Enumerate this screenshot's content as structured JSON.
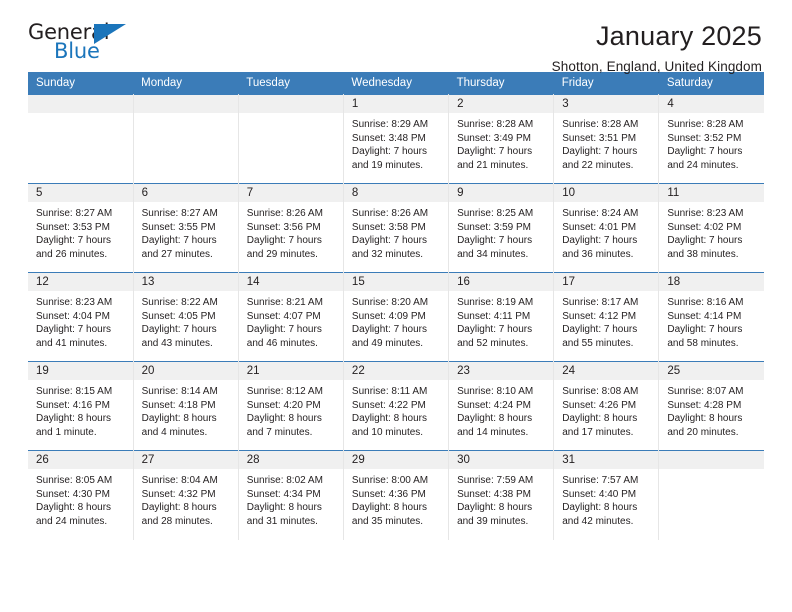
{
  "brand": {
    "name_part1": "General",
    "name_part2": "Blue",
    "accent_color": "#1b75bb"
  },
  "header": {
    "month_title": "January 2025",
    "location": "Shotton, England, United Kingdom",
    "header_bg_color": "#3b7cb8"
  },
  "weekdays": [
    {
      "label": "Sunday"
    },
    {
      "label": "Monday"
    },
    {
      "label": "Tuesday"
    },
    {
      "label": "Wednesday"
    },
    {
      "label": "Thursday"
    },
    {
      "label": "Friday"
    },
    {
      "label": "Saturday"
    }
  ],
  "weeks": [
    [
      {
        "day": "",
        "sunrise": "",
        "sunset": "",
        "daylight1": "",
        "daylight2": ""
      },
      {
        "day": "",
        "sunrise": "",
        "sunset": "",
        "daylight1": "",
        "daylight2": ""
      },
      {
        "day": "",
        "sunrise": "",
        "sunset": "",
        "daylight1": "",
        "daylight2": ""
      },
      {
        "day": "1",
        "sunrise": "Sunrise: 8:29 AM",
        "sunset": "Sunset: 3:48 PM",
        "daylight1": "Daylight: 7 hours",
        "daylight2": "and 19 minutes."
      },
      {
        "day": "2",
        "sunrise": "Sunrise: 8:28 AM",
        "sunset": "Sunset: 3:49 PM",
        "daylight1": "Daylight: 7 hours",
        "daylight2": "and 21 minutes."
      },
      {
        "day": "3",
        "sunrise": "Sunrise: 8:28 AM",
        "sunset": "Sunset: 3:51 PM",
        "daylight1": "Daylight: 7 hours",
        "daylight2": "and 22 minutes."
      },
      {
        "day": "4",
        "sunrise": "Sunrise: 8:28 AM",
        "sunset": "Sunset: 3:52 PM",
        "daylight1": "Daylight: 7 hours",
        "daylight2": "and 24 minutes."
      }
    ],
    [
      {
        "day": "5",
        "sunrise": "Sunrise: 8:27 AM",
        "sunset": "Sunset: 3:53 PM",
        "daylight1": "Daylight: 7 hours",
        "daylight2": "and 26 minutes."
      },
      {
        "day": "6",
        "sunrise": "Sunrise: 8:27 AM",
        "sunset": "Sunset: 3:55 PM",
        "daylight1": "Daylight: 7 hours",
        "daylight2": "and 27 minutes."
      },
      {
        "day": "7",
        "sunrise": "Sunrise: 8:26 AM",
        "sunset": "Sunset: 3:56 PM",
        "daylight1": "Daylight: 7 hours",
        "daylight2": "and 29 minutes."
      },
      {
        "day": "8",
        "sunrise": "Sunrise: 8:26 AM",
        "sunset": "Sunset: 3:58 PM",
        "daylight1": "Daylight: 7 hours",
        "daylight2": "and 32 minutes."
      },
      {
        "day": "9",
        "sunrise": "Sunrise: 8:25 AM",
        "sunset": "Sunset: 3:59 PM",
        "daylight1": "Daylight: 7 hours",
        "daylight2": "and 34 minutes."
      },
      {
        "day": "10",
        "sunrise": "Sunrise: 8:24 AM",
        "sunset": "Sunset: 4:01 PM",
        "daylight1": "Daylight: 7 hours",
        "daylight2": "and 36 minutes."
      },
      {
        "day": "11",
        "sunrise": "Sunrise: 8:23 AM",
        "sunset": "Sunset: 4:02 PM",
        "daylight1": "Daylight: 7 hours",
        "daylight2": "and 38 minutes."
      }
    ],
    [
      {
        "day": "12",
        "sunrise": "Sunrise: 8:23 AM",
        "sunset": "Sunset: 4:04 PM",
        "daylight1": "Daylight: 7 hours",
        "daylight2": "and 41 minutes."
      },
      {
        "day": "13",
        "sunrise": "Sunrise: 8:22 AM",
        "sunset": "Sunset: 4:05 PM",
        "daylight1": "Daylight: 7 hours",
        "daylight2": "and 43 minutes."
      },
      {
        "day": "14",
        "sunrise": "Sunrise: 8:21 AM",
        "sunset": "Sunset: 4:07 PM",
        "daylight1": "Daylight: 7 hours",
        "daylight2": "and 46 minutes."
      },
      {
        "day": "15",
        "sunrise": "Sunrise: 8:20 AM",
        "sunset": "Sunset: 4:09 PM",
        "daylight1": "Daylight: 7 hours",
        "daylight2": "and 49 minutes."
      },
      {
        "day": "16",
        "sunrise": "Sunrise: 8:19 AM",
        "sunset": "Sunset: 4:11 PM",
        "daylight1": "Daylight: 7 hours",
        "daylight2": "and 52 minutes."
      },
      {
        "day": "17",
        "sunrise": "Sunrise: 8:17 AM",
        "sunset": "Sunset: 4:12 PM",
        "daylight1": "Daylight: 7 hours",
        "daylight2": "and 55 minutes."
      },
      {
        "day": "18",
        "sunrise": "Sunrise: 8:16 AM",
        "sunset": "Sunset: 4:14 PM",
        "daylight1": "Daylight: 7 hours",
        "daylight2": "and 58 minutes."
      }
    ],
    [
      {
        "day": "19",
        "sunrise": "Sunrise: 8:15 AM",
        "sunset": "Sunset: 4:16 PM",
        "daylight1": "Daylight: 8 hours",
        "daylight2": "and 1 minute."
      },
      {
        "day": "20",
        "sunrise": "Sunrise: 8:14 AM",
        "sunset": "Sunset: 4:18 PM",
        "daylight1": "Daylight: 8 hours",
        "daylight2": "and 4 minutes."
      },
      {
        "day": "21",
        "sunrise": "Sunrise: 8:12 AM",
        "sunset": "Sunset: 4:20 PM",
        "daylight1": "Daylight: 8 hours",
        "daylight2": "and 7 minutes."
      },
      {
        "day": "22",
        "sunrise": "Sunrise: 8:11 AM",
        "sunset": "Sunset: 4:22 PM",
        "daylight1": "Daylight: 8 hours",
        "daylight2": "and 10 minutes."
      },
      {
        "day": "23",
        "sunrise": "Sunrise: 8:10 AM",
        "sunset": "Sunset: 4:24 PM",
        "daylight1": "Daylight: 8 hours",
        "daylight2": "and 14 minutes."
      },
      {
        "day": "24",
        "sunrise": "Sunrise: 8:08 AM",
        "sunset": "Sunset: 4:26 PM",
        "daylight1": "Daylight: 8 hours",
        "daylight2": "and 17 minutes."
      },
      {
        "day": "25",
        "sunrise": "Sunrise: 8:07 AM",
        "sunset": "Sunset: 4:28 PM",
        "daylight1": "Daylight: 8 hours",
        "daylight2": "and 20 minutes."
      }
    ],
    [
      {
        "day": "26",
        "sunrise": "Sunrise: 8:05 AM",
        "sunset": "Sunset: 4:30 PM",
        "daylight1": "Daylight: 8 hours",
        "daylight2": "and 24 minutes."
      },
      {
        "day": "27",
        "sunrise": "Sunrise: 8:04 AM",
        "sunset": "Sunset: 4:32 PM",
        "daylight1": "Daylight: 8 hours",
        "daylight2": "and 28 minutes."
      },
      {
        "day": "28",
        "sunrise": "Sunrise: 8:02 AM",
        "sunset": "Sunset: 4:34 PM",
        "daylight1": "Daylight: 8 hours",
        "daylight2": "and 31 minutes."
      },
      {
        "day": "29",
        "sunrise": "Sunrise: 8:00 AM",
        "sunset": "Sunset: 4:36 PM",
        "daylight1": "Daylight: 8 hours",
        "daylight2": "and 35 minutes."
      },
      {
        "day": "30",
        "sunrise": "Sunrise: 7:59 AM",
        "sunset": "Sunset: 4:38 PM",
        "daylight1": "Daylight: 8 hours",
        "daylight2": "and 39 minutes."
      },
      {
        "day": "31",
        "sunrise": "Sunrise: 7:57 AM",
        "sunset": "Sunset: 4:40 PM",
        "daylight1": "Daylight: 8 hours",
        "daylight2": "and 42 minutes."
      },
      {
        "day": "",
        "sunrise": "",
        "sunset": "",
        "daylight1": "",
        "daylight2": ""
      }
    ]
  ]
}
